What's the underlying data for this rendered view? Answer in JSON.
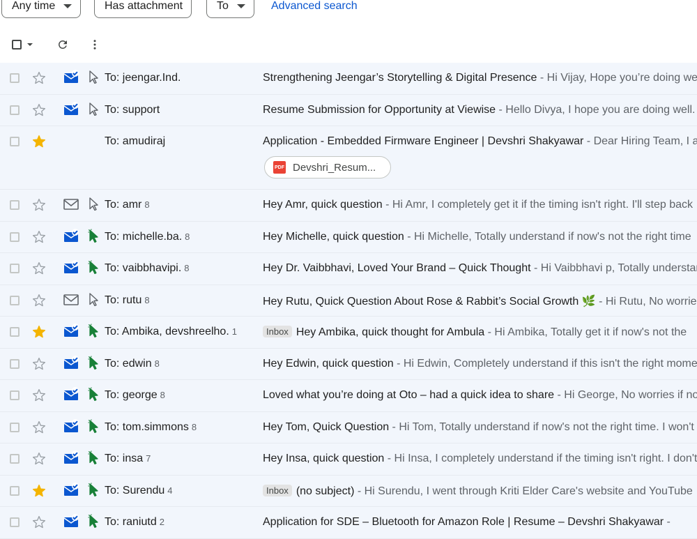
{
  "filters": {
    "any_time": "Any time",
    "has_attachment": "Has attachment",
    "to": "To",
    "advanced_search": "Advanced search"
  },
  "colors": {
    "accent": "#0b57d0",
    "row_bg": "#f2f6fc",
    "star_on": "#f4b400",
    "important_on": "#188038",
    "envelope": "#0b57d0"
  },
  "emails": [
    {
      "sender": "To: jeengar.Ind.",
      "count": "",
      "label": "",
      "subject": "Strengthening Jeengar’s Storytelling & Digital Presence",
      "snippet": " - Hi Vijay, Hope you’re doing well",
      "starred": false,
      "envelope": "read",
      "important": "outline"
    },
    {
      "sender": "To: support",
      "count": "",
      "label": "",
      "subject": "Resume Submission for Opportunity at Viewise",
      "snippet": " - Hello Divya, I hope you are doing well.",
      "starred": false,
      "envelope": "read",
      "important": "outline"
    },
    {
      "sender": "To: amudiraj",
      "count": "",
      "label": "",
      "subject": "Application - Embedded Firmware Engineer | Devshri Shakyawar",
      "snippet": " - Dear Hiring Team, I am",
      "starred": true,
      "envelope": "none",
      "important": "none",
      "attachment": "Devshri_Resum..."
    },
    {
      "sender": "To: amr",
      "count": "8",
      "label": "",
      "subject": "Hey Amr, quick question",
      "snippet": " - Hi Amr, I completely get it if the timing isn't right. I'll step back",
      "starred": false,
      "envelope": "outline",
      "important": "outline"
    },
    {
      "sender": "To: michelle.ba.",
      "count": "8",
      "label": "",
      "subject": "Hey Michelle, quick question",
      "snippet": " - Hi Michelle, Totally understand if now's not the right time",
      "starred": false,
      "envelope": "read",
      "important": "filled"
    },
    {
      "sender": "To: vaibbhavipi.",
      "count": "8",
      "label": "",
      "subject": "Hey Dr. Vaibbhavi, Loved Your Brand – Quick Thought",
      "snippet": " - Hi Vaibbhavi p, Totally understand",
      "starred": false,
      "envelope": "read",
      "important": "filled"
    },
    {
      "sender": "To: rutu",
      "count": "8",
      "label": "",
      "subject": "Hey Rutu, Quick Question About Rose & Rabbit’s Social Growth 🌿",
      "snippet": " - Hi Rutu, No worries",
      "starred": false,
      "envelope": "outline",
      "important": "outline"
    },
    {
      "sender": "To: Ambika, devshreelho.",
      "count": "1",
      "label": "Inbox",
      "subject": "Hey Ambika, quick thought for Ambula",
      "snippet": " - Hi Ambika, Totally get it if now's not the",
      "starred": true,
      "envelope": "read",
      "important": "filled"
    },
    {
      "sender": "To: edwin",
      "count": "8",
      "label": "",
      "subject": "Hey Edwin, quick question",
      "snippet": " - Hi Edwin, Completely understand if this isn't the right moment",
      "starred": false,
      "envelope": "read",
      "important": "filled"
    },
    {
      "sender": "To: george",
      "count": "8",
      "label": "",
      "subject": "Loved what you’re doing at Oto – had a quick idea to share",
      "snippet": " - Hi George, No worries if now",
      "starred": false,
      "envelope": "read",
      "important": "filled"
    },
    {
      "sender": "To: tom.simmons",
      "count": "8",
      "label": "",
      "subject": "Hey Tom, Quick Question",
      "snippet": " - Hi Tom, Totally understand if now's not the right time. I won't",
      "starred": false,
      "envelope": "read",
      "important": "filled"
    },
    {
      "sender": "To: insa",
      "count": "7",
      "label": "",
      "subject": "Hey Insa, quick question",
      "snippet": " - Hi Insa, I completely understand if the timing isn't right. I don't",
      "starred": false,
      "envelope": "read",
      "important": "filled"
    },
    {
      "sender": "To: Surendu",
      "count": "4",
      "label": "Inbox",
      "subject": "(no subject)",
      "snippet": " - Hi Surendu, I went through Kriti Elder Care's website and YouTube",
      "starred": true,
      "envelope": "read",
      "important": "filled"
    },
    {
      "sender": "To: raniutd",
      "count": "2",
      "label": "",
      "subject": "Application for SDE – Bluetooth for Amazon Role | Resume – Devshri Shakyawar",
      "snippet": " - ",
      "starred": false,
      "envelope": "read",
      "important": "filled"
    }
  ]
}
